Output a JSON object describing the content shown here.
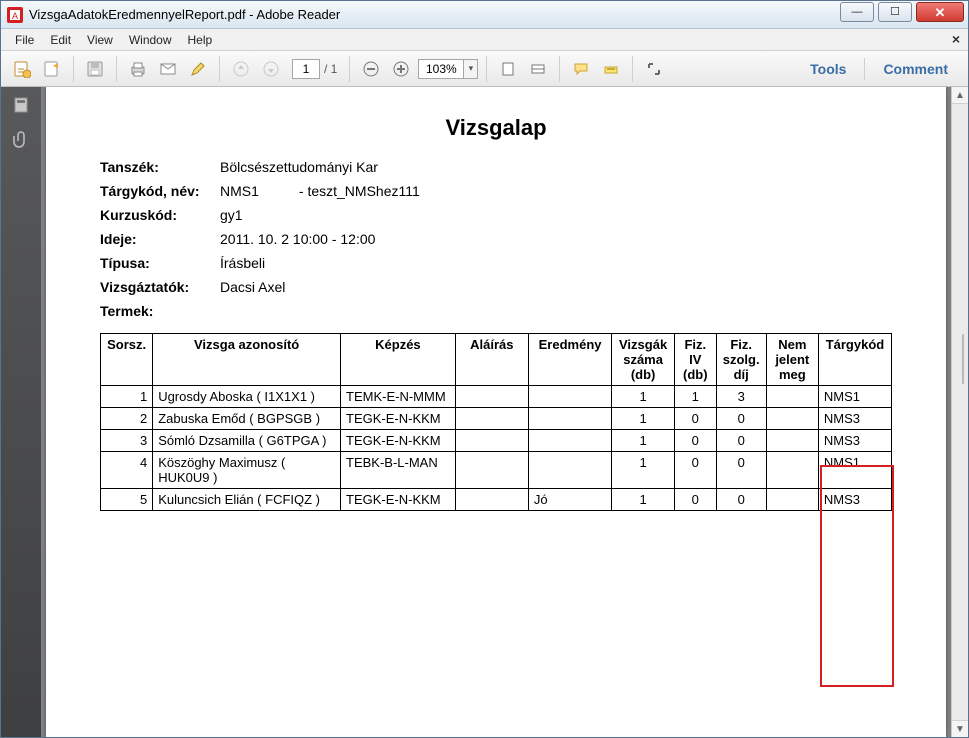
{
  "window": {
    "title": "VizsgaAdatokEredmennyelReport.pdf - Adobe Reader"
  },
  "menu": {
    "file": "File",
    "edit": "Edit",
    "view": "View",
    "window": "Window",
    "help": "Help"
  },
  "toolbar": {
    "page_current": "1",
    "page_total": "/ 1",
    "zoom_value": "103%",
    "tools_label": "Tools",
    "comment_label": "Comment"
  },
  "doc": {
    "title": "Vizsgalap",
    "labels": {
      "tanszek": "Tanszék:",
      "targykod": "Tárgykód, név:",
      "kurzuskod": "Kurzuskód:",
      "ideje": "Ideje:",
      "tipusa": "Típusa:",
      "vizsgaztatok": "Vizsgáztatók:",
      "termek": "Termek:"
    },
    "values": {
      "tanszek": "Bölcsészettudományi Kar",
      "targykod": "NMS1",
      "targynev": "- teszt_NMShez111",
      "kurzuskod": "gy1",
      "ideje": "2011. 10. 2 10:00  - 12:00",
      "tipusa": "Írásbeli",
      "vizsgaztatok": "Dacsi Axel",
      "termek": ""
    },
    "headers": {
      "sorsz": "Sorsz.",
      "vizsga_azon": "Vizsga azonosító",
      "kepzes": "Képzés",
      "alairas": "Aláírás",
      "eredmeny": "Eredmény",
      "vizsgak": "Vizsgák száma (db)",
      "fiziv": "Fiz. IV (db)",
      "fizszolg": "Fiz. szolg. díj",
      "nemjelent": "Nem jelent meg",
      "targykod": "Tárgykód"
    },
    "rows": [
      {
        "sorsz": "1",
        "azon": "Ugrosdy Aboska ( I1X1X1 )",
        "kepzes": "TEMK-E-N-MMM",
        "alairas": "",
        "eredmeny": "",
        "vizsgak": "1",
        "fiziv": "1",
        "fizszolg": "3",
        "nemjelent": "",
        "targykod": "NMS1"
      },
      {
        "sorsz": "2",
        "azon": "Zabuska Emőd ( BGPSGB )",
        "kepzes": "TEGK-E-N-KKM",
        "alairas": "",
        "eredmeny": "",
        "vizsgak": "1",
        "fiziv": "0",
        "fizszolg": "0",
        "nemjelent": "",
        "targykod": "NMS3"
      },
      {
        "sorsz": "3",
        "azon": "Sómló Dzsamilla ( G6TPGA )",
        "kepzes": "TEGK-E-N-KKM",
        "alairas": "",
        "eredmeny": "",
        "vizsgak": "1",
        "fiziv": "0",
        "fizszolg": "0",
        "nemjelent": "",
        "targykod": "NMS3"
      },
      {
        "sorsz": "4",
        "azon": "Köszöghy Maximusz ( HUK0U9 )",
        "kepzes": "TEBK-B-L-MAN",
        "alairas": "",
        "eredmeny": "",
        "vizsgak": "1",
        "fiziv": "0",
        "fizszolg": "0",
        "nemjelent": "",
        "targykod": "NMS1"
      },
      {
        "sorsz": "5",
        "azon": "Kuluncsich Elián ( FCFIQZ )",
        "kepzes": "TEGK-E-N-KKM",
        "alairas": "",
        "eredmeny": "Jó",
        "vizsgak": "1",
        "fiziv": "0",
        "fizszolg": "0",
        "nemjelent": "",
        "targykod": "NMS3"
      }
    ]
  }
}
